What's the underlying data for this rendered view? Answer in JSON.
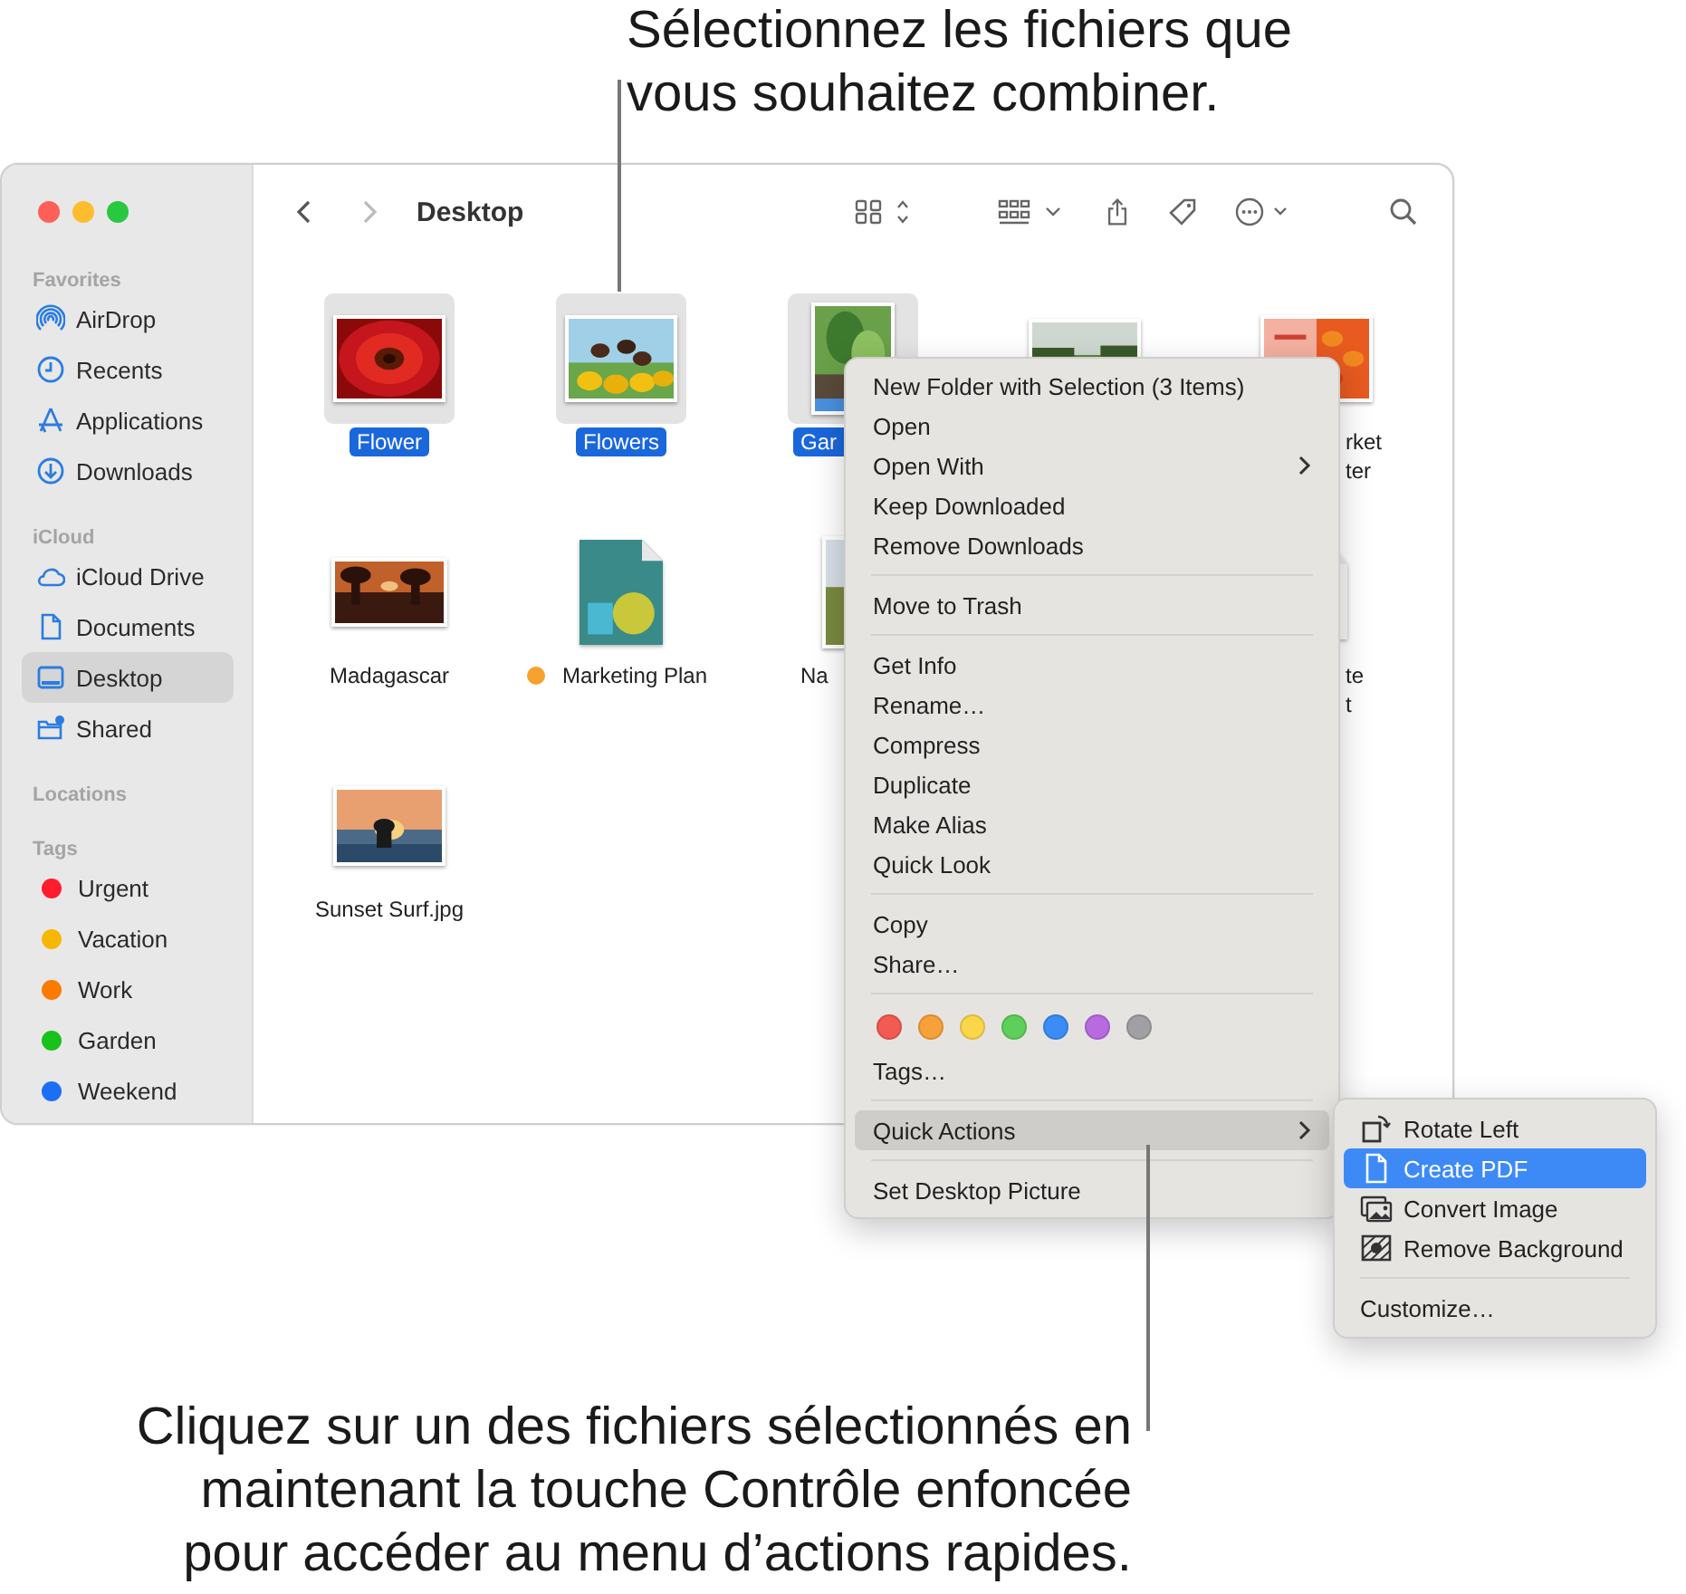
{
  "callouts": [
    {
      "text": "Sélectionnez les fichiers que vous souhaitez combiner."
    },
    {
      "text": "Cliquez sur un des fichiers sélectionnés en maintenant la touche Contrôle enfoncée pour accéder au menu d’actions rapides."
    }
  ],
  "toolbar": {
    "title": "Desktop",
    "back_enabled": true,
    "forward_enabled": false
  },
  "sidebar": {
    "sections": [
      {
        "title": "Favorites",
        "items": [
          {
            "kind": "place",
            "label": "AirDrop",
            "selected": false
          },
          {
            "kind": "place",
            "label": "Recents",
            "selected": false
          },
          {
            "kind": "place",
            "label": "Applications",
            "selected": false
          },
          {
            "kind": "place",
            "label": "Downloads",
            "selected": false
          }
        ]
      },
      {
        "title": "iCloud",
        "items": [
          {
            "kind": "place",
            "label": "iCloud Drive",
            "selected": false
          },
          {
            "kind": "place",
            "label": "Documents",
            "selected": false
          },
          {
            "kind": "place",
            "label": "Desktop",
            "selected": true
          },
          {
            "kind": "place",
            "label": "Shared",
            "selected": false
          }
        ]
      },
      {
        "title": "Locations"
      },
      {
        "title": "Tags",
        "items": [
          {
            "kind": "tag",
            "label": "Urgent",
            "color": "#fe1d2c",
            "selected": false
          },
          {
            "kind": "tag",
            "label": "Vacation",
            "color": "#f6b700",
            "selected": false
          },
          {
            "kind": "tag",
            "label": "Work",
            "color": "#fb7a00",
            "selected": false
          },
          {
            "kind": "tag",
            "label": "Garden",
            "color": "#17c21b",
            "selected": false
          },
          {
            "kind": "tag",
            "label": "Weekend",
            "color": "#1b6ff5",
            "selected": false
          }
        ]
      }
    ]
  },
  "file_rows": [
    {
      "files": [
        {
          "kind": "picture",
          "label": "Flower",
          "selected": true
        },
        {
          "kind": "picture",
          "label": "Flowers",
          "selected": true
        },
        {
          "kind": "picture",
          "label": "Gar",
          "selected": true
        },
        {
          "kind": "picture",
          "selected": false
        },
        {
          "kind": "picture",
          "label": "rket\nter",
          "selected": false
        }
      ]
    },
    {
      "files": [
        {
          "kind": "picture",
          "label": "Madagascar",
          "selected": false
        },
        {
          "kind": "document",
          "label": "Marketing Plan",
          "color": "#f7a12e",
          "selected": false
        },
        {
          "kind": "picture",
          "label": "Na",
          "selected": false
        },
        {
          "kind": "document",
          "label": "te\nt",
          "selected": false
        }
      ]
    },
    {
      "files": [
        {
          "kind": "picture",
          "label": "Sunset Surf.jpg",
          "selected": false
        }
      ]
    }
  ],
  "context_menu": {
    "items": [
      {
        "kind": "item",
        "label": "New Folder with Selection (3 Items)",
        "submenu": false,
        "selected": false
      },
      {
        "kind": "item",
        "label": "Open",
        "submenu": false,
        "selected": false
      },
      {
        "kind": "item",
        "label": "Open With",
        "submenu": true,
        "selected": false
      },
      {
        "kind": "item",
        "label": "Keep Downloaded",
        "submenu": false,
        "selected": false
      },
      {
        "kind": "item",
        "label": "Remove Downloads",
        "submenu": false,
        "selected": false
      },
      {
        "kind": "separator"
      },
      {
        "kind": "item",
        "label": "Move to Trash",
        "submenu": false,
        "selected": false
      },
      {
        "kind": "separator"
      },
      {
        "kind": "item",
        "label": "Get Info",
        "submenu": false,
        "selected": false
      },
      {
        "kind": "item",
        "label": "Rename…",
        "submenu": false,
        "selected": false
      },
      {
        "kind": "item",
        "label": "Compress",
        "submenu": false,
        "selected": false
      },
      {
        "kind": "item",
        "label": "Duplicate",
        "submenu": false,
        "selected": false
      },
      {
        "kind": "item",
        "label": "Make Alias",
        "submenu": false,
        "selected": false
      },
      {
        "kind": "item",
        "label": "Quick Look",
        "submenu": false,
        "selected": false
      },
      {
        "kind": "separator"
      },
      {
        "kind": "item",
        "label": "Copy",
        "submenu": false,
        "selected": false
      },
      {
        "kind": "item",
        "label": "Share…",
        "submenu": false,
        "selected": false
      },
      {
        "kind": "separator"
      },
      {
        "kind": "colors",
        "colors": [
          {
            "color": "#f25a52"
          },
          {
            "color": "#f7a13a"
          },
          {
            "color": "#fbd54a"
          },
          {
            "color": "#5fcf5b"
          },
          {
            "color": "#3b8cf6"
          },
          {
            "color": "#b86ae0"
          },
          {
            "color": "#a0a0a4"
          }
        ]
      },
      {
        "kind": "item",
        "label": "Tags…",
        "submenu": false,
        "selected": false
      },
      {
        "kind": "separator"
      },
      {
        "kind": "item",
        "label": "Quick Actions",
        "submenu": true,
        "selected": true
      },
      {
        "kind": "separator"
      },
      {
        "kind": "item",
        "label": "Set Desktop Picture",
        "submenu": false,
        "selected": false
      }
    ]
  },
  "quick_actions_menu": {
    "items": [
      {
        "kind": "item",
        "label": "Rotate Left",
        "selected": false
      },
      {
        "kind": "item",
        "label": "Create PDF",
        "selected": true
      },
      {
        "kind": "item",
        "label": "Convert Image",
        "selected": false
      },
      {
        "kind": "item",
        "label": "Remove Background",
        "selected": false
      },
      {
        "kind": "separator"
      },
      {
        "kind": "plain",
        "label": "Customize…",
        "selected": false
      }
    ]
  }
}
